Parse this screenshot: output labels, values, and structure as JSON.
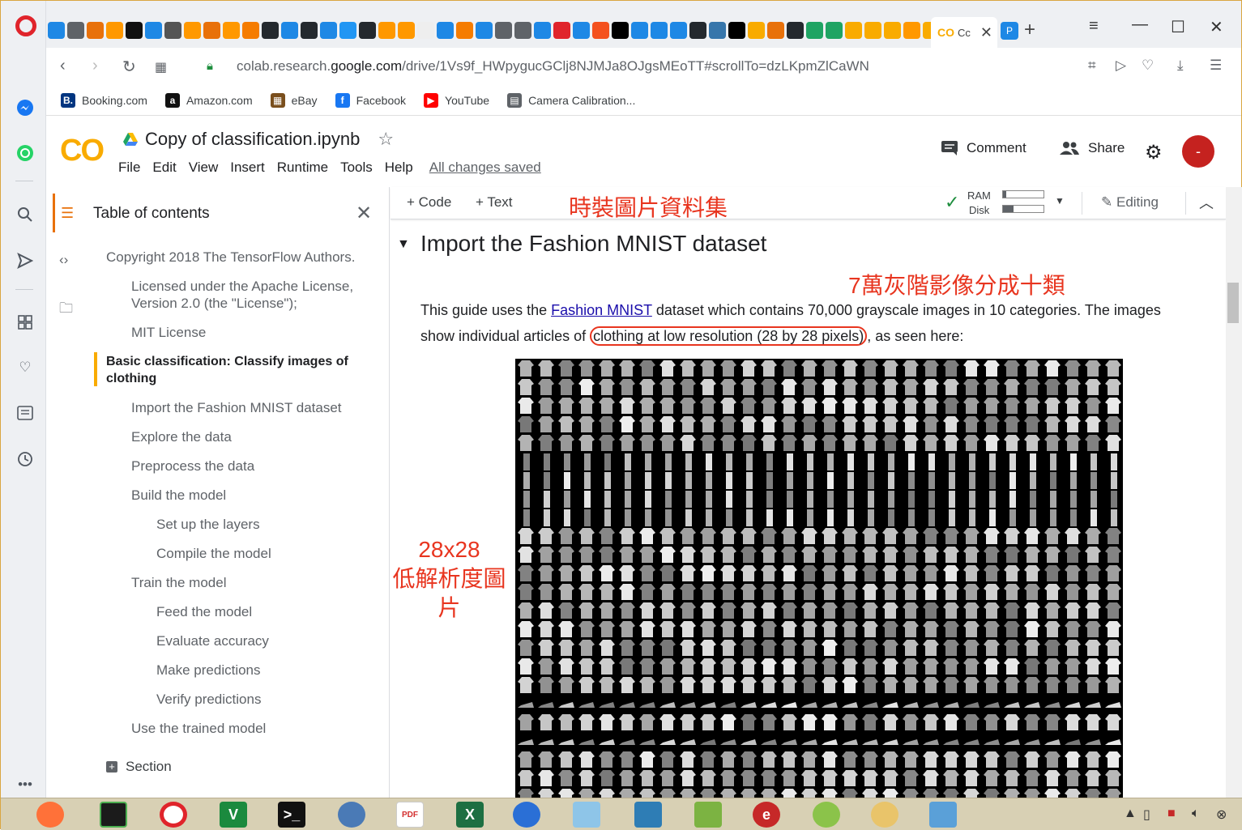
{
  "browser": {
    "active_tab_label": "Cc",
    "url_prefix": "colab.research.",
    "url_domain": "google.com",
    "url_path": "/drive/1Vs9f_HWpygucGClj8NJMJa8OJgsMEoTT#scrollTo=dzLKpmZlCaWN",
    "bookmarks": [
      {
        "label": "Booking.com",
        "icon": "B.",
        "color": "#003580"
      },
      {
        "label": "Amazon.com",
        "icon": "a",
        "color": "#111111"
      },
      {
        "label": "eBay",
        "icon": "▦",
        "color": "#7a4f1d"
      },
      {
        "label": "Facebook",
        "icon": "f",
        "color": "#1877f2"
      },
      {
        "label": "YouTube",
        "icon": "▶",
        "color": "#ff0000"
      },
      {
        "label": "Camera Calibration...",
        "icon": "▤",
        "color": "#5f6368"
      }
    ]
  },
  "colab": {
    "logo_text": "CO",
    "notebook_title": "Copy of classification.ipynb",
    "menus": [
      "File",
      "Edit",
      "View",
      "Insert",
      "Runtime",
      "Tools",
      "Help"
    ],
    "saved_status": "All changes saved",
    "comment_label": "Comment",
    "share_label": "Share",
    "avatar_letter": "-",
    "toolbar": {
      "code_label": "Code",
      "text_label": "Text",
      "ram_label": "RAM",
      "disk_label": "Disk",
      "editing_label": "Editing",
      "ram_usage": 0.08,
      "disk_usage": 0.25
    }
  },
  "toc": {
    "title": "Table of contents",
    "entries": [
      "Copyright 2018 The TensorFlow Authors.",
      "Licensed under the Apache License, Version 2.0 (the \"License\");",
      "MIT License",
      "Basic classification: Classify images of clothing",
      "Import the Fashion MNIST dataset",
      "Explore the data",
      "Preprocess the data",
      "Build the model",
      "Set up the layers",
      "Compile the model",
      "Train the model",
      "Feed the model",
      "Evaluate accuracy",
      "Make predictions",
      "Verify predictions",
      "Use the trained model"
    ],
    "section_label": "Section"
  },
  "cell": {
    "heading": "Import the Fashion MNIST dataset",
    "para_before_link": "This guide uses the ",
    "link_text": "Fashion MNIST",
    "para_after_link": " dataset which contains 70,000 grayscale images in 10 categories. The images show individual articles of ",
    "para_circled": "clothing at low resolution (28 by 28 pixels)",
    "para_end": ", as seen here:"
  },
  "annotations": {
    "top_banner": "時裝圖片資料集",
    "count_note": "7萬灰階影像分成十類",
    "size_line1": "28x28",
    "size_line2": "低解析度圖片"
  }
}
